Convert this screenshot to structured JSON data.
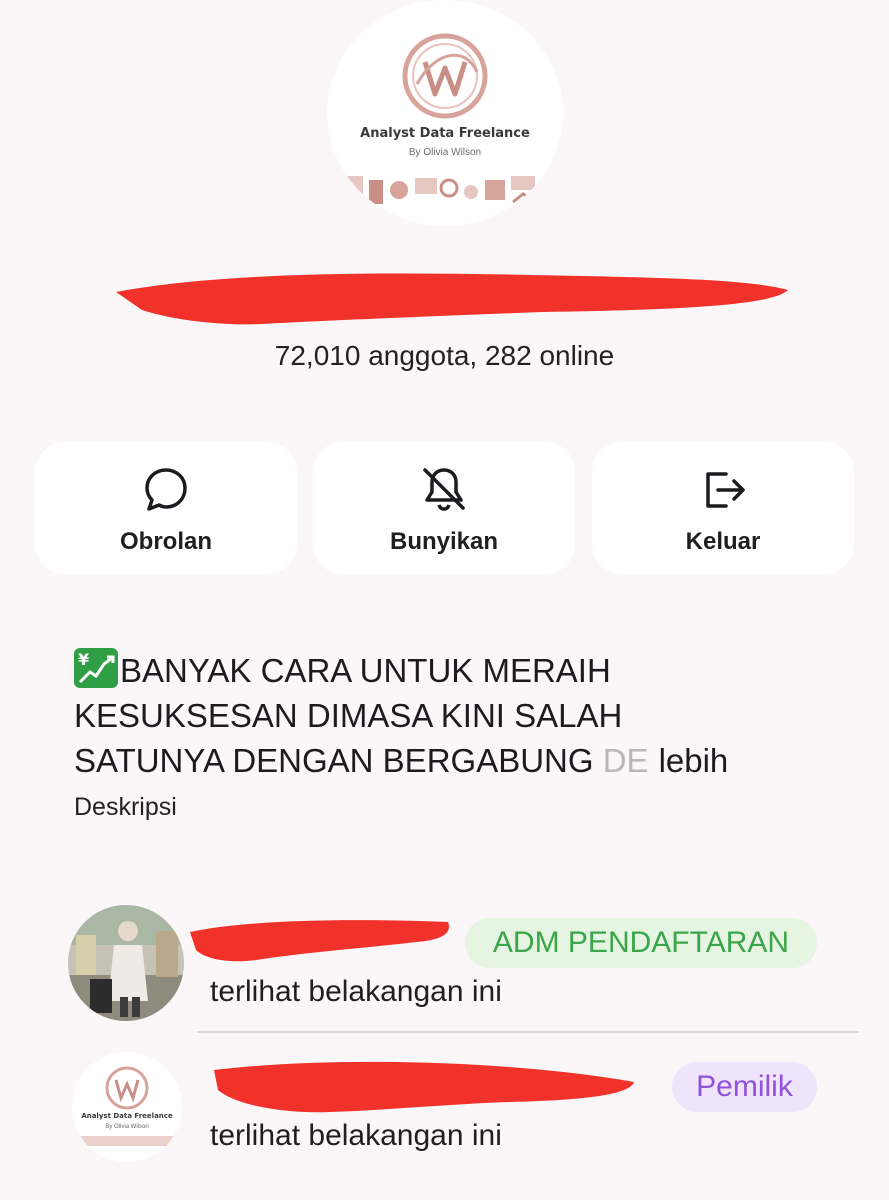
{
  "group": {
    "logo_title": "Analyst Data Freelance",
    "logo_subtitle": "By Olivia Wilson",
    "members_text": "72,010 anggota, 282 online"
  },
  "actions": [
    {
      "label": "Obrolan",
      "icon": "chat-bubble-icon"
    },
    {
      "label": "Bunyikan",
      "icon": "bell-off-icon"
    },
    {
      "label": "Keluar",
      "icon": "logout-icon"
    }
  ],
  "description": {
    "emoji": "chart-increasing-with-yen-icon",
    "line1": "BANYAK CARA UNTUK MERAIH",
    "line2": "KESUKSESAN DIMASA KINI SALAH",
    "line3": "SATUNYA DENGAN BERGABUNG ",
    "line3_faded": "DE",
    "more": "lebih",
    "label": "Deskripsi"
  },
  "members": [
    {
      "role_badge": "ADM PENDAFTARAN",
      "status": "terlihat belakangan ini"
    },
    {
      "role_badge": "Pemilik",
      "status": "terlihat belakangan ini",
      "avatar_title": "Analyst Data Freelance",
      "avatar_subtitle": "By Olivia Wilson"
    }
  ],
  "colors": {
    "background": "#fbf6f8",
    "redaction": "#f0322a",
    "admin_badge_text": "#3aa54a",
    "admin_badge_bg": "#e6f4e2",
    "owner_badge_text": "#8f52d8",
    "owner_badge_bg": "#efe4fb",
    "logo_rose": "#d8a39a"
  }
}
